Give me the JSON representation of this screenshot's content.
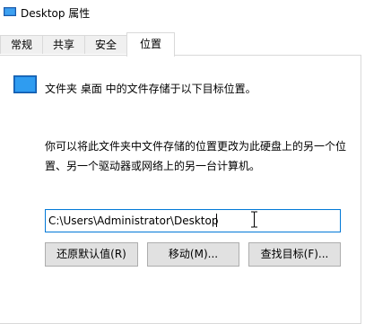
{
  "window": {
    "title": "Desktop 属性"
  },
  "tabs": [
    {
      "label": "常规"
    },
    {
      "label": "共享"
    },
    {
      "label": "安全"
    },
    {
      "label": "位置",
      "active": true
    }
  ],
  "location": {
    "info": "文件夹 桌面 中的文件存储于以下目标位置。",
    "description": "你可以将此文件夹中文件存储的位置更改为此硬盘上的另一个位置、另一个驱动器或网络上的另一台计算机。",
    "path_value": "C:\\Users\\Administrator\\Desktop",
    "buttons": {
      "restore_default": "还原默认值(R)",
      "move": "移动(M)...",
      "find_target": "查找目标(F)..."
    }
  },
  "icons": {
    "title": "folder-icon",
    "folder": "desktop-folder-icon",
    "cursor": "ibeam-cursor-icon"
  },
  "colors": {
    "accent": "#0078d7",
    "folder_blue": "#1e90e0"
  }
}
